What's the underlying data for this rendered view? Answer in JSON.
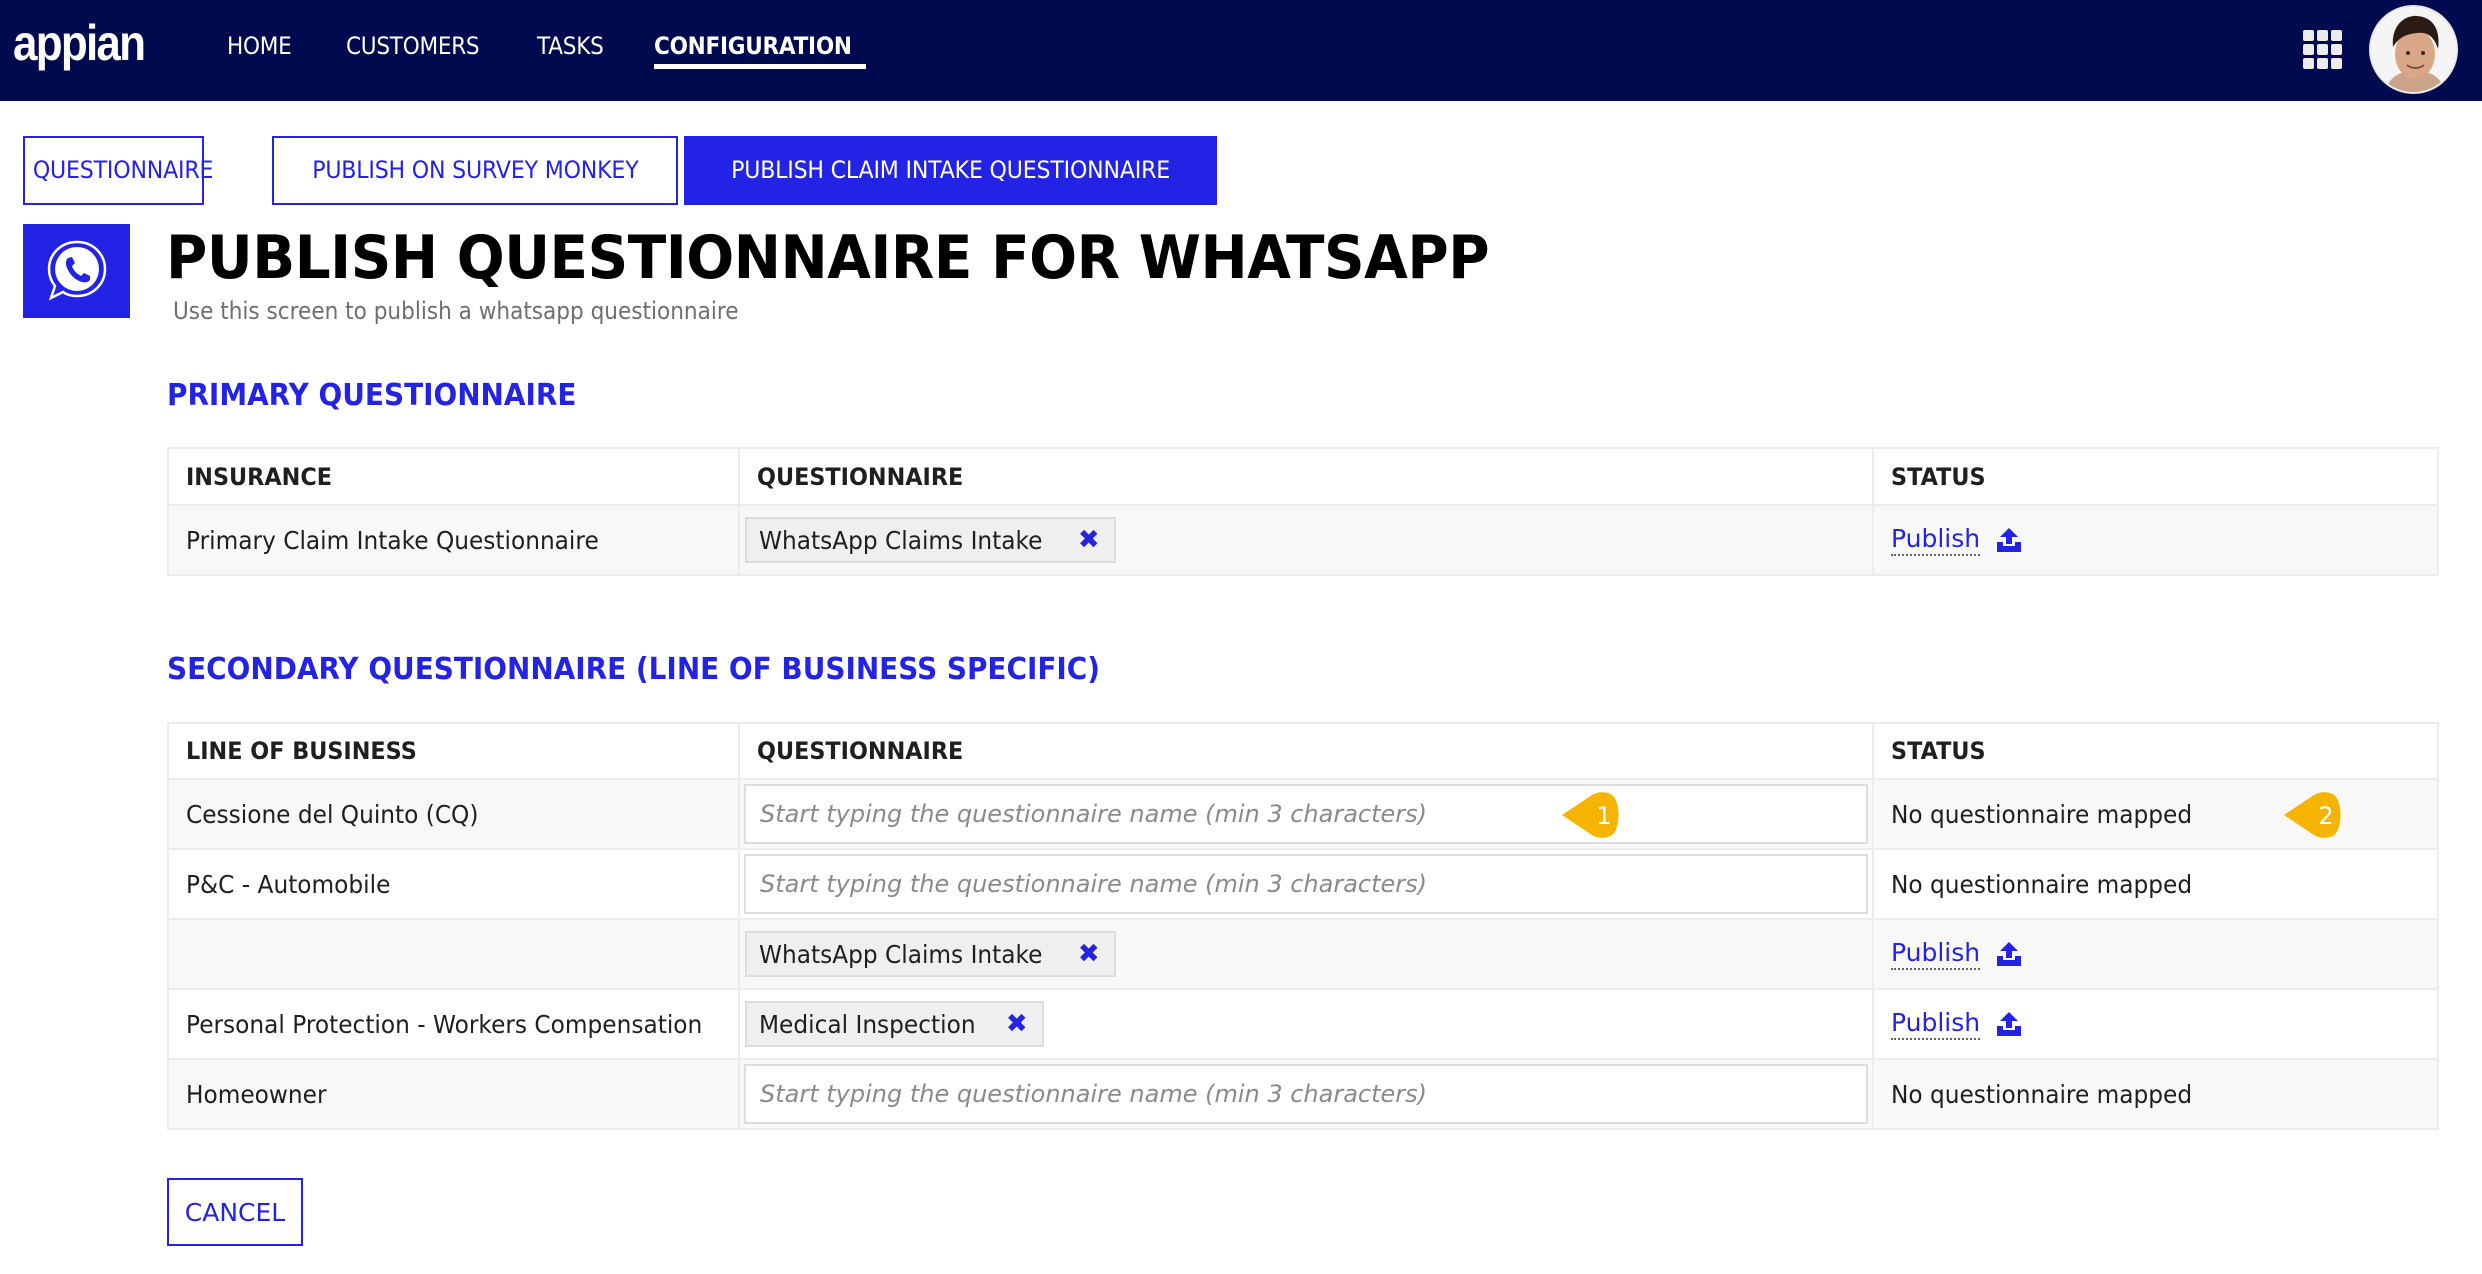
{
  "app": {
    "logo": "appian"
  },
  "nav": {
    "items": [
      {
        "label": "HOME",
        "active": false
      },
      {
        "label": "CUSTOMERS",
        "active": false
      },
      {
        "label": "TASKS",
        "active": false
      },
      {
        "label": "CONFIGURATION",
        "active": true
      }
    ],
    "apps_icon": "grid-icon",
    "avatar": "user-avatar"
  },
  "tabs": [
    {
      "label": "QUESTIONNAIRE",
      "active": false
    },
    {
      "label": "PUBLISH ON SURVEY MONKEY",
      "active": false
    },
    {
      "label": "PUBLISH CLAIM INTAKE QUESTIONNAIRE",
      "active": true
    }
  ],
  "page": {
    "icon": "whatsapp-icon",
    "title": "PUBLISH QUESTIONNAIRE FOR WHATSAPP",
    "subtitle": "Use this screen to publish a whatsapp questionnaire"
  },
  "primary": {
    "title": "PRIMARY QUESTIONNAIRE",
    "columns": [
      "INSURANCE",
      "QUESTIONNAIRE",
      "STATUS"
    ],
    "rows": [
      {
        "insurance": "Primary Claim Intake Questionnaire",
        "questionnaire": "WhatsApp Claims Intake",
        "status": "Publish"
      }
    ]
  },
  "secondary": {
    "title": "SECONDARY QUESTIONNAIRE (LINE OF BUSINESS SPECIFIC)",
    "columns": [
      "LINE OF BUSINESS",
      "QUESTIONNAIRE",
      "STATUS"
    ],
    "placeholder": "Start typing the questionnaire name (min 3 characters)",
    "rows": [
      {
        "line_of_business": "Cessione del Quinto (CQ)",
        "questionnaire": "",
        "status": "No questionnaire mapped"
      },
      {
        "line_of_business": "P&C - Automobile",
        "questionnaire": "",
        "status": "No questionnaire mapped"
      },
      {
        "line_of_business": "",
        "questionnaire": "WhatsApp Claims Intake",
        "status": "Publish"
      },
      {
        "line_of_business": "Personal Protection - Workers Compensation",
        "questionnaire": "Medical Inspection",
        "status": "Publish"
      },
      {
        "line_of_business": "Homeowner",
        "questionnaire": "",
        "status": "No questionnaire mapped"
      }
    ]
  },
  "annotations": [
    {
      "label": "1",
      "color": "#f5b400"
    },
    {
      "label": "2",
      "color": "#f5b400"
    }
  ],
  "actions": {
    "cancel_label": "CANCEL"
  },
  "colors": {
    "navbar": "#000b4f",
    "accent": "#2323e6",
    "marker": "#f5b400"
  }
}
